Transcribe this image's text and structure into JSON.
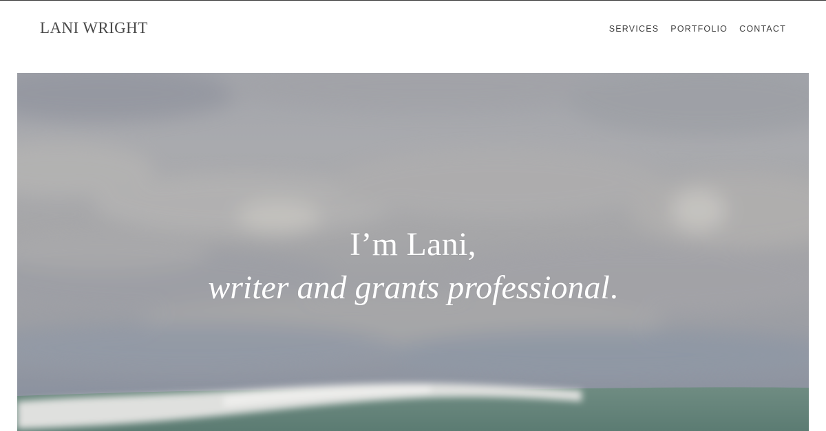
{
  "header": {
    "site_title": "LANI WRIGHT",
    "nav": [
      {
        "label": "SERVICES"
      },
      {
        "label": "PORTFOLIO"
      },
      {
        "label": "CONTACT"
      }
    ]
  },
  "hero": {
    "line1": "I’m Lani,",
    "line2_italic": "writer and grants professional",
    "line2_suffix": ".",
    "image": "cloudy sky over ocean wave"
  },
  "colors": {
    "text": "#4a4a4a",
    "hero_text": "#ffffff",
    "sky": "#a6a6a8",
    "sea": "#6f8a80"
  }
}
